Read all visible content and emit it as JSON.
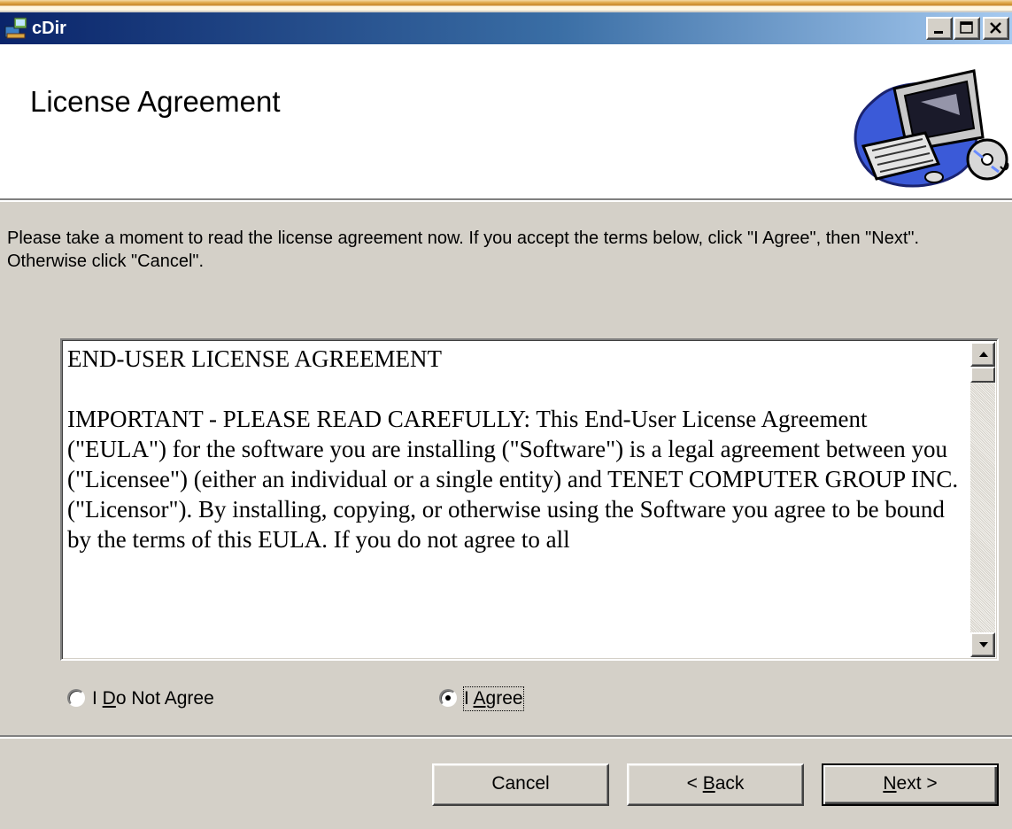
{
  "window": {
    "title": "cDir"
  },
  "header": {
    "title": "License Agreement"
  },
  "instructions": "Please take a moment to read the license agreement now. If you accept the terms below, click \"I Agree\", then \"Next\". Otherwise click \"Cancel\".",
  "license": {
    "heading": "END-USER LICENSE AGREEMENT",
    "body": "IMPORTANT - PLEASE READ CAREFULLY:  This End-User License Agreement (\"EULA\") for the software you are installing (\"Software\") is a legal agreement between you (\"Licensee\") (either an individual or a single entity) and TENET COMPUTER GROUP INC. (\"Licensor\").  By installing, copying, or otherwise using the Software you agree to be bound by the terms of this EULA.  If you do not agree to all"
  },
  "options": {
    "do_not_agree_prefix": "I ",
    "do_not_agree_accel": "D",
    "do_not_agree_rest": "o Not Agree",
    "agree_prefix": "I ",
    "agree_accel": "A",
    "agree_rest": "gree",
    "selected": "agree"
  },
  "buttons": {
    "cancel": "Cancel",
    "back_prefix": "< ",
    "back_accel": "B",
    "back_rest": "ack",
    "next_accel": "N",
    "next_rest": "ext >"
  },
  "icons": {
    "app": "installer-icon",
    "minimize": "minimize-icon",
    "maximize": "maximize-icon",
    "close": "close-icon",
    "header_art": "computer-clipart-icon"
  },
  "colors": {
    "titlebar_start": "#0a246a",
    "titlebar_end": "#a6caf0",
    "face": "#d4d0c8"
  }
}
